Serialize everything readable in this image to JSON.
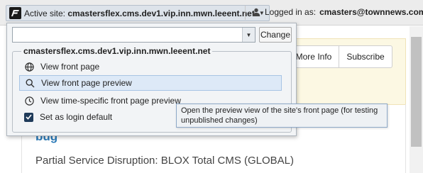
{
  "topbar": {
    "active_site_label": "Active site:",
    "active_site_value": "cmastersflex.cms.dev1.vip.inn.mwn.leeent.net",
    "logged_in_label": "Logged in as:",
    "logged_in_value": "cmasters@townnews.com"
  },
  "page": {
    "more_info": "More Info",
    "subscribe": "Subscribe",
    "incident_title": "bug",
    "incident_desc": "Partial Service Disruption: BLOX Total CMS (GLOBAL)"
  },
  "popover": {
    "select_value": "",
    "change_label": "Change",
    "group_legend": "cmastersflex.cms.dev1.vip.inn.mwn.leeent.net",
    "options": [
      {
        "label": "View front page",
        "icon": "globe-icon"
      },
      {
        "label": "View front page preview",
        "icon": "search-preview-icon",
        "selected": true
      },
      {
        "label": "View time-specific front page preview",
        "icon": "clock-icon"
      }
    ],
    "login_default_label": "Set as login default",
    "login_default_checked": true
  },
  "tooltip": {
    "text": "Open the preview view of the site's front page (for testing unpublished changes)"
  }
}
